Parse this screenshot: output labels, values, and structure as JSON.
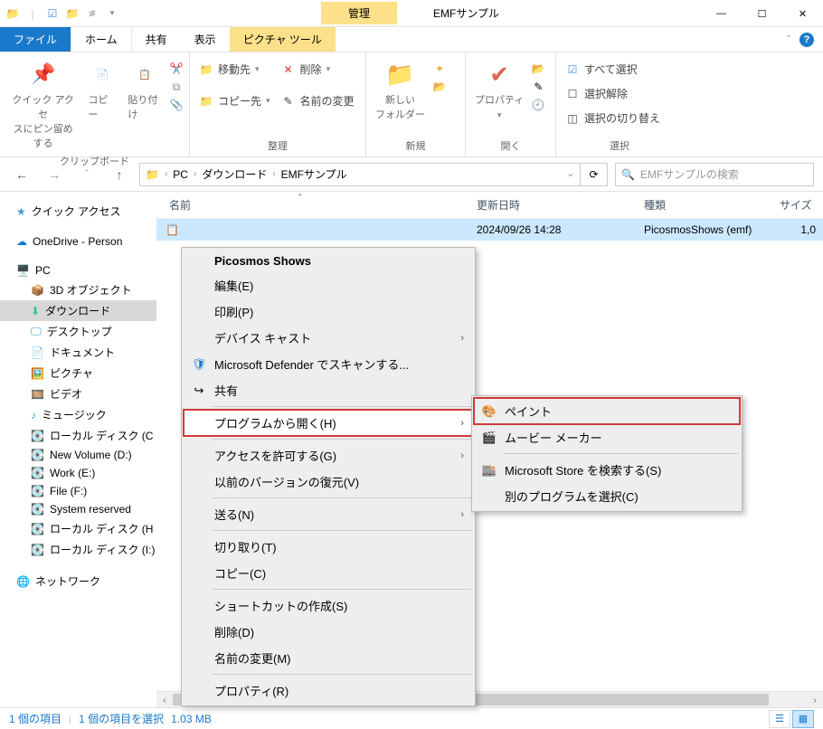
{
  "window": {
    "title": "EMFサンプル",
    "manage_tab": "管理"
  },
  "tabs": {
    "file": "ファイル",
    "home": "ホーム",
    "share": "共有",
    "view": "表示",
    "picture_tools": "ピクチャ ツール"
  },
  "ribbon": {
    "clipboard": {
      "label": "クリップボード",
      "quick_access": "クイック アクセ\nスにピン留めする",
      "copy": "コピー",
      "paste": "貼り付け"
    },
    "organize": {
      "label": "整理",
      "move_to": "移動先",
      "delete": "削除",
      "copy_to": "コピー先",
      "rename": "名前の変更"
    },
    "new": {
      "label": "新規",
      "new_folder": "新しい\nフォルダー"
    },
    "open": {
      "label": "開く",
      "properties": "プロパティ"
    },
    "select": {
      "label": "選択",
      "select_all": "すべて選択",
      "select_none": "選択解除",
      "invert": "選択の切り替え"
    }
  },
  "address": {
    "pc": "PC",
    "downloads": "ダウンロード",
    "folder": "EMFサンプル",
    "search_placeholder": "EMFサンプルの検索"
  },
  "columns": {
    "name": "名前",
    "date": "更新日時",
    "type": "種類",
    "size": "サイズ"
  },
  "file": {
    "date": "2024/09/26 14:28",
    "type": "PicosmosShows (emf)",
    "size": "1,0"
  },
  "nav": {
    "quick_access": "クイック アクセス",
    "onedrive": "OneDrive - Person",
    "pc": "PC",
    "objects_3d": "3D オブジェクト",
    "downloads": "ダウンロード",
    "desktop": "デスクトップ",
    "documents": "ドキュメント",
    "pictures": "ピクチャ",
    "videos": "ビデオ",
    "music": "ミュージック",
    "disk_c": "ローカル ディスク (C",
    "new_volume": "New Volume (D:)",
    "work_e": "Work (E:)",
    "file_f": "File (F:)",
    "system_reserved": "System reserved",
    "disk_h": "ローカル ディスク (H",
    "disk_i": "ローカル ディスク (I:)",
    "network": "ネットワーク"
  },
  "context": {
    "open_default": "Picosmos Shows",
    "edit": "編集(E)",
    "print": "印刷(P)",
    "device_cast": "デバイス キャスト",
    "defender": "Microsoft Defender でスキャンする...",
    "share": "共有",
    "open_with": "プログラムから開く(H)",
    "give_access": "アクセスを許可する(G)",
    "restore": "以前のバージョンの復元(V)",
    "send_to": "送る(N)",
    "cut": "切り取り(T)",
    "copy": "コピー(C)",
    "create_shortcut": "ショートカットの作成(S)",
    "delete": "削除(D)",
    "rename": "名前の変更(M)",
    "properties": "プロパティ(R)"
  },
  "submenu": {
    "paint": "ペイント",
    "movie_maker": "ムービー メーカー",
    "search_store": "Microsoft Store を検索する(S)",
    "choose_app": "別のプログラムを選択(C)"
  },
  "status": {
    "items": "1 個の項目",
    "selected": "1 個の項目を選択",
    "size": "1.03 MB"
  }
}
